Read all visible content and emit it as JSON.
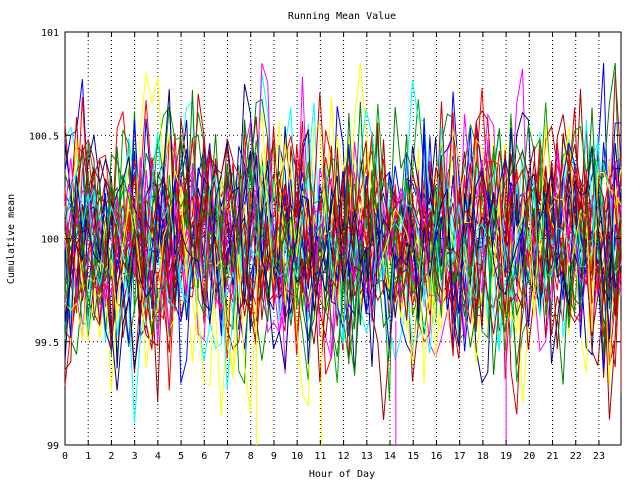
{
  "chart_data": {
    "type": "line",
    "title": "Running Mean Value",
    "xlabel": "Hour of Day",
    "ylabel": "Cumulative mean",
    "xlim": [
      0,
      23.95
    ],
    "ylim": [
      99,
      101
    ],
    "x_ticks": [
      0,
      1,
      2,
      3,
      4,
      5,
      6,
      7,
      8,
      9,
      10,
      11,
      12,
      13,
      14,
      15,
      16,
      17,
      18,
      19,
      20,
      21,
      22,
      23
    ],
    "x_tick_labels": [
      "0",
      "1",
      "2",
      "3",
      "4",
      "5",
      "6",
      "7",
      "8",
      "9",
      "10",
      "11",
      "12",
      "13",
      "14",
      "15",
      "16",
      "17",
      "18",
      "19",
      "20",
      "21",
      "22",
      "23"
    ],
    "y_ticks": [
      99,
      99.5,
      100,
      100.5,
      101
    ],
    "y_tick_labels": [
      "99",
      "99.5",
      "100",
      "100.5",
      "101"
    ],
    "grid": true,
    "legend": "none",
    "series_count": 40,
    "points_per_series": 97,
    "value_center": 100.0,
    "typical_range": [
      99.3,
      100.8
    ],
    "series_colors": [
      "#0000ff",
      "#ff0000",
      "#00a000",
      "#cc0000",
      "#ff00ff",
      "#00ffff",
      "#ffff00",
      "#008000",
      "#000080",
      "#a00000"
    ],
    "notes_visible": []
  }
}
